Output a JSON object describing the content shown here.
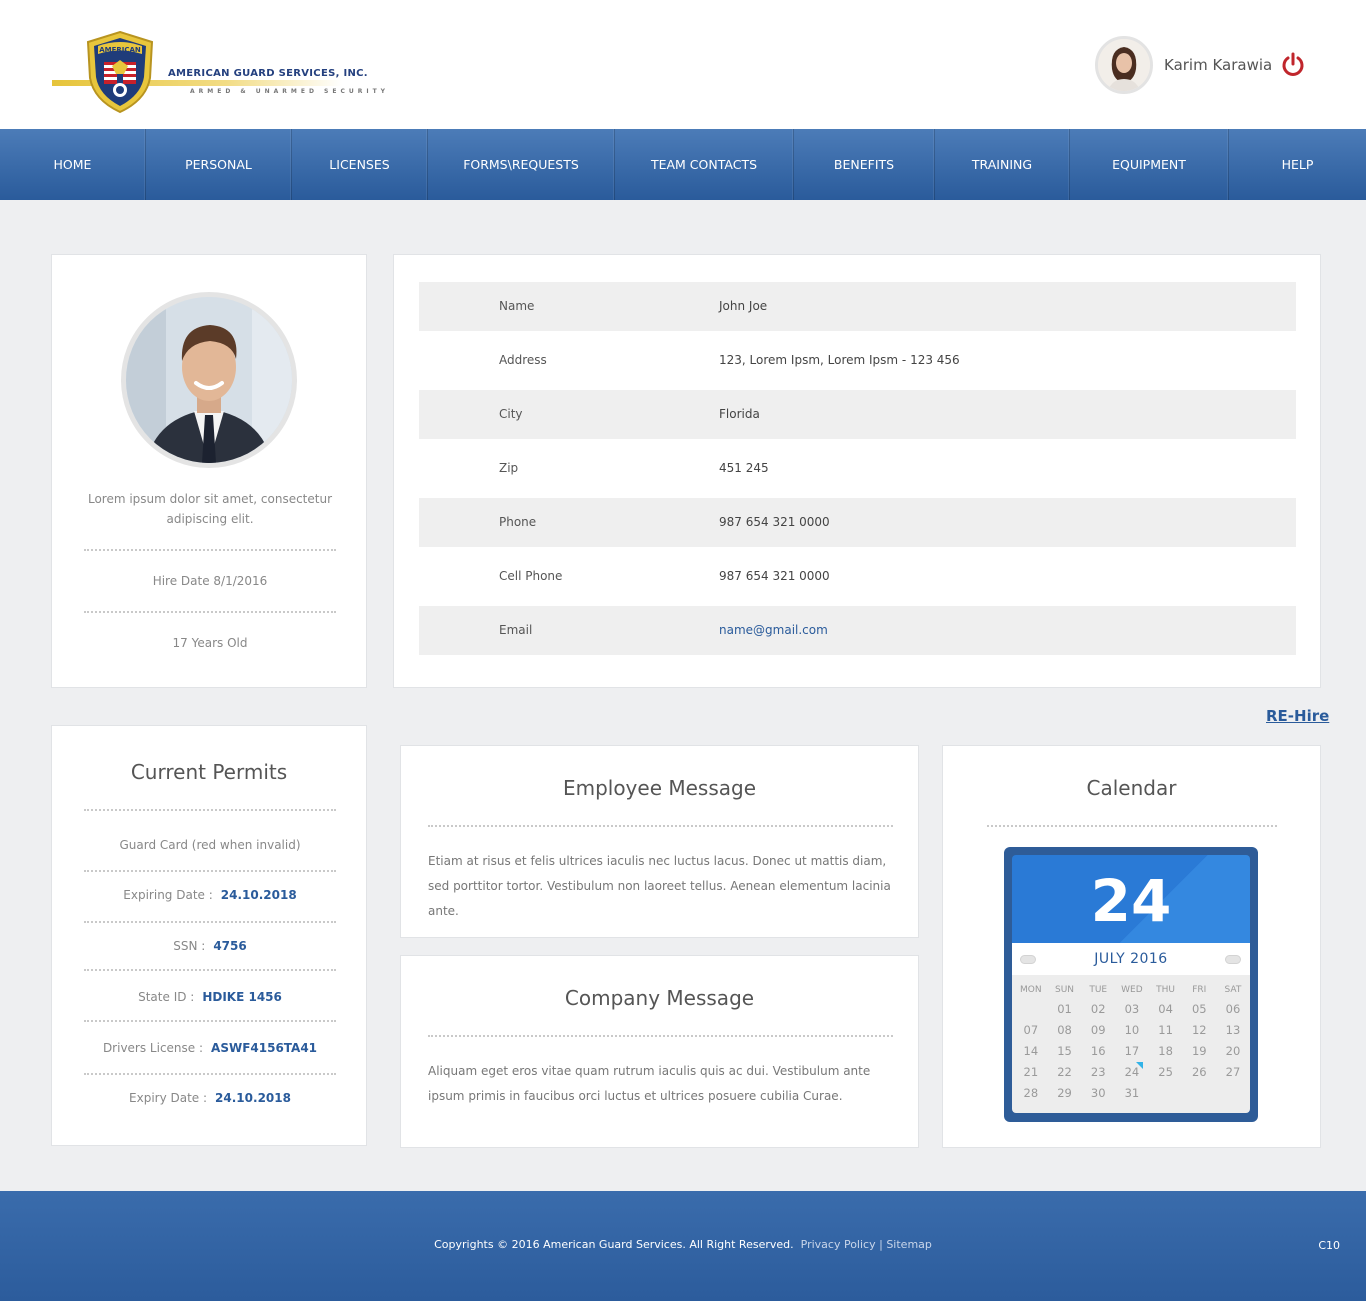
{
  "brand": {
    "shield_text": "AMERICAN",
    "name": "AMERICAN GUARD SERVICES, INC.",
    "tagline": "ARMED & UNARMED SECURITY"
  },
  "user": {
    "name": "Karim Karawia"
  },
  "nav": [
    "HOME",
    "PERSONAL",
    "LICENSES",
    "FORMS\\REQUESTS",
    "TEAM CONTACTS",
    "BENEFITS",
    "TRAINING",
    "EQUIPMENT",
    "HELP"
  ],
  "profile": {
    "bio": "Lorem ipsum dolor sit amet, consectetur adipiscing elit.",
    "hire_date": "Hire Date 8/1/2016",
    "age": "17 Years Old"
  },
  "details": [
    {
      "label": "Name",
      "value": "John Joe"
    },
    {
      "label": "Address",
      "value": "123, Lorem Ipsm, Lorem Ipsm - 123 456"
    },
    {
      "label": "City",
      "value": "Florida"
    },
    {
      "label": "Zip",
      "value": "451 245"
    },
    {
      "label": "Phone",
      "value": "987 654 321 0000"
    },
    {
      "label": "Cell Phone",
      "value": "987 654 321 0000"
    },
    {
      "label": "Email",
      "value": "name@gmail.com"
    }
  ],
  "rehire_label": "RE-Hire",
  "permits": {
    "title": "Current Permits",
    "guard_card": "Guard Card (red when invalid)",
    "items": [
      {
        "label": "Expiring Date :",
        "value": "24.10.2018"
      },
      {
        "label": "SSN :",
        "value": "4756"
      },
      {
        "label": "State ID :",
        "value": "HDIKE 1456"
      },
      {
        "label": "Drivers License :",
        "value": "ASWF4156TA41"
      },
      {
        "label": "Expiry Date :",
        "value": "24.10.2018"
      }
    ]
  },
  "employee_message": {
    "title": "Employee Message",
    "text": "Etiam at risus et felis ultrices iaculis nec luctus lacus. Donec ut mattis diam, sed porttitor tortor. Vestibulum non laoreet tellus. Aenean elementum lacinia ante."
  },
  "company_message": {
    "title": "Company Message",
    "text": "Aliquam eget eros vitae quam rutrum iaculis quis ac dui. Vestibulum ante ipsum primis in faucibus orci luctus et ultrices posuere cubilia Curae."
  },
  "calendar": {
    "title": "Calendar",
    "day": "24",
    "month_year": "JULY  2016",
    "weekdays": [
      "MON",
      "SUN",
      "TUE",
      "WED",
      "THU",
      "FRI",
      "SAT"
    ],
    "weeks": [
      [
        "",
        "01",
        "02",
        "03",
        "04",
        "05",
        "06"
      ],
      [
        "07",
        "08",
        "09",
        "10",
        "11",
        "12",
        "13"
      ],
      [
        "14",
        "15",
        "16",
        "17",
        "18",
        "19",
        "20"
      ],
      [
        "21",
        "22",
        "23",
        "24",
        "25",
        "26",
        "27"
      ],
      [
        "28",
        "29",
        "30",
        "31",
        "",
        "",
        ""
      ]
    ],
    "today": "24"
  },
  "footer": {
    "copyright": "Copyrights © 2016 American Guard Services. All Right Reserved.",
    "privacy": "Privacy Policy",
    "separator": "|",
    "sitemap": "Sitemap",
    "code": "C10"
  },
  "colors": {
    "brand_blue": "#2a5b9b",
    "nav_top": "#4c7cb8",
    "power_red": "#c0262c",
    "calendar_blue": "#2a7ad6"
  }
}
